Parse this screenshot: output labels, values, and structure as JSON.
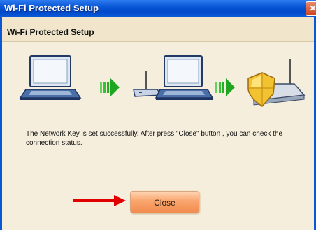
{
  "window": {
    "title": "Wi-Fi Protected Setup",
    "close_glyph": "✕"
  },
  "header": {
    "title": "Wi-Fi Protected Setup"
  },
  "illustration": {
    "items": [
      "laptop-icon",
      "green-arrow-icon",
      "router-laptop-icon",
      "green-arrow-icon",
      "secured-router-icon"
    ]
  },
  "message": {
    "text": "The Network Key is set successfully. After press \"Close\" button , you can check the connection status."
  },
  "actions": {
    "close_label": "Close"
  },
  "colors": {
    "titlebar": "#0a57d6",
    "client_bg": "#f6eedd",
    "button": "#f39a5f",
    "arrow": "#e00000"
  }
}
